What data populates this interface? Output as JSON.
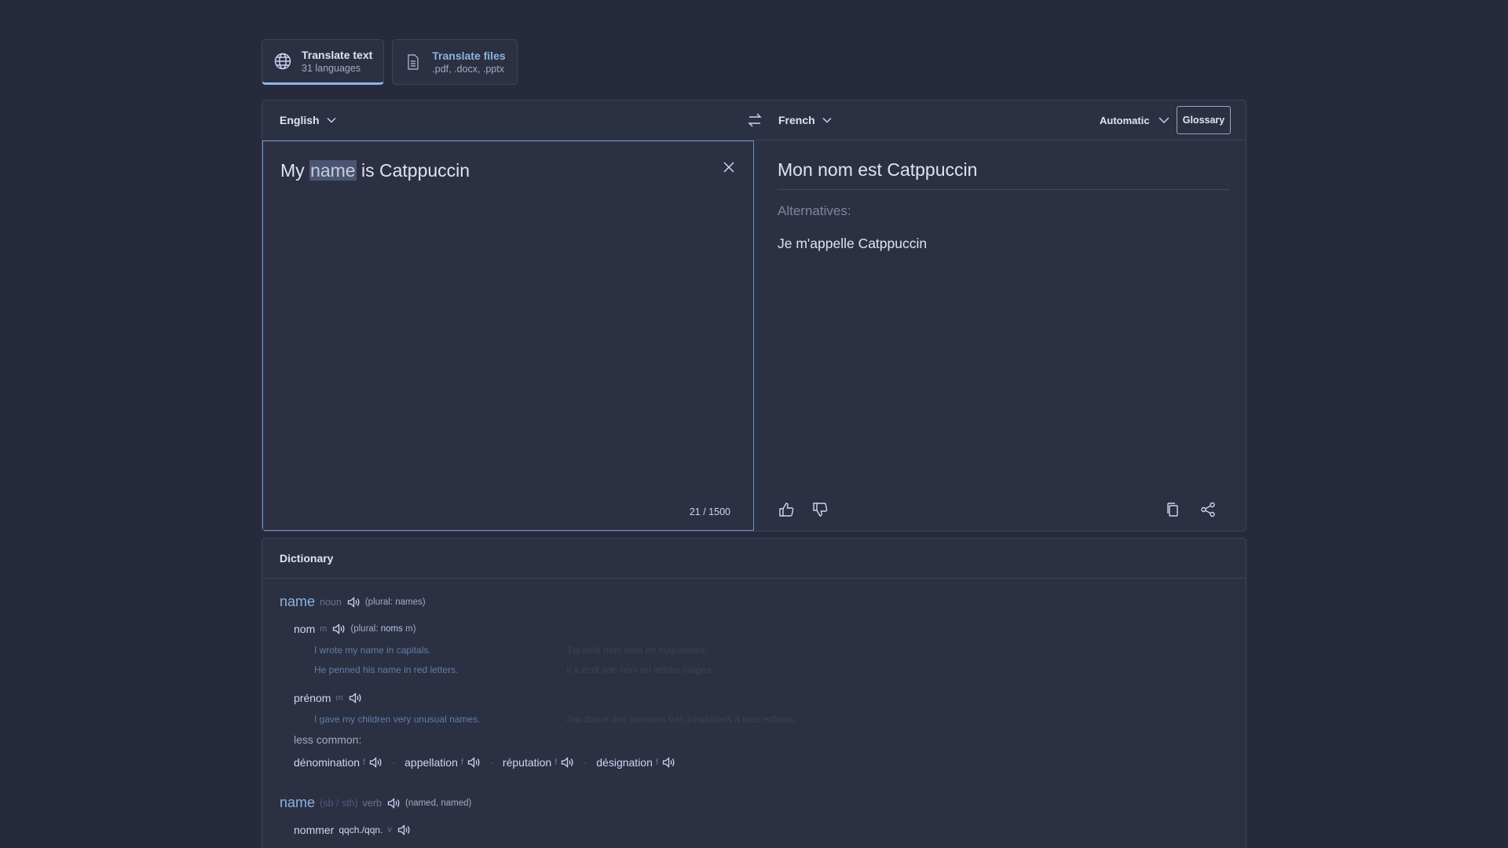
{
  "tabs": [
    {
      "title": "Translate text",
      "subtitle": "31 languages"
    },
    {
      "title": "Translate files",
      "subtitle": ".pdf, .docx, .pptx"
    }
  ],
  "translator": {
    "source_lang": "English",
    "target_lang": "French",
    "formality": "Automatic",
    "glossary_label": "Glossary",
    "source_before": "My ",
    "source_highlight": "name",
    "source_after": " is Catppuccin",
    "char_count": "21 / 1500",
    "translation": "Mon nom est Catppuccin",
    "alternatives_label": "Alternatives:",
    "alternatives": [
      "Je m'appelle Catppuccin"
    ]
  },
  "dictionary": {
    "title": "Dictionary",
    "entries": [
      {
        "headword": "name",
        "pos": "noun",
        "plural_prefix": "(plural:",
        "plural": "names)",
        "senses": [
          {
            "word": "nom",
            "gender": "m",
            "plural_prefix": "(plural:",
            "plural_word": "noms",
            "plural_gender": "m",
            "plural_close": ")",
            "examples": [
              {
                "en": "I wrote my name in capitals.",
                "fr": "J'ai écrit mon nom en majuscules."
              },
              {
                "en": "He penned his name in red letters.",
                "fr": "Il a écrit son nom en lettres rouges."
              }
            ]
          },
          {
            "word": "prénom",
            "gender": "m",
            "examples": [
              {
                "en": "I gave my children very unusual names.",
                "fr": "J'ai donné des prénoms très inhabituels à mes enfants."
              }
            ]
          }
        ],
        "less_common_label": "less common:",
        "less_common": [
          {
            "word": "dénomination",
            "gender": "f"
          },
          {
            "word": "appellation",
            "gender": "f"
          },
          {
            "word": "réputation",
            "gender": "f"
          },
          {
            "word": "désignation",
            "gender": "f"
          }
        ],
        "separator": "·"
      },
      {
        "headword": "name",
        "object": "(sb / sth)",
        "pos": "verb",
        "forms": "(named, named)",
        "senses": [
          {
            "word": "nommer",
            "object": "qqch./qqn.",
            "gender": "v"
          }
        ]
      }
    ]
  },
  "colors": {
    "background": "#262a3c",
    "panel": "#2c3043",
    "accent": "#89b4e0",
    "border": "#3f4459"
  }
}
